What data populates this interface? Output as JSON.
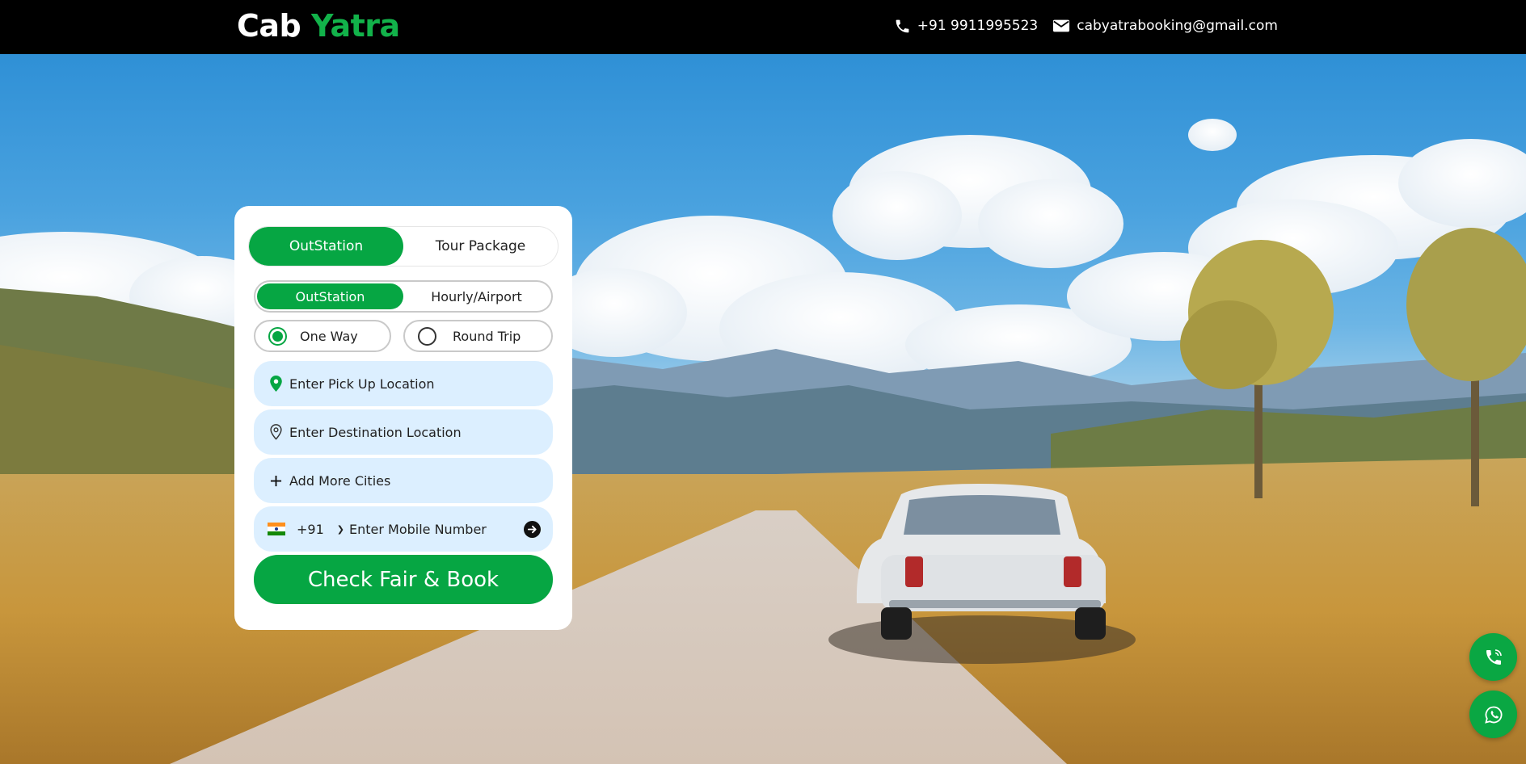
{
  "header": {
    "logo_part1": "Cab",
    "logo_part2": "Yatra",
    "phone": "+91 9911995523",
    "email": "cabyatrabooking@gmail.com",
    "phone_icon": "phone-icon",
    "email_icon": "envelope-icon"
  },
  "booking": {
    "main_tabs": [
      "OutStation",
      "Tour Package"
    ],
    "main_tab_active": "OutStation",
    "sub_tabs": [
      "OutStation",
      "Hourly/Airport"
    ],
    "sub_tab_active": "OutStation",
    "trip_types": [
      "One Way",
      "Round Trip"
    ],
    "trip_type_selected": "One Way",
    "pickup_placeholder": "Enter Pick Up Location",
    "destination_placeholder": "Enter Destination Location",
    "add_cities": "Add More Cities",
    "country_code": "+91",
    "mobile_placeholder": "Enter Mobile Number",
    "submit_label": "Check Fair & Book"
  },
  "colors": {
    "brand_green": "#06a643",
    "logo_green": "#12b24a",
    "field_bg": "#dcefff",
    "header_bg": "#000000"
  },
  "floating": {
    "call_icon": "phone-call-icon",
    "whatsapp_icon": "whatsapp-icon"
  }
}
